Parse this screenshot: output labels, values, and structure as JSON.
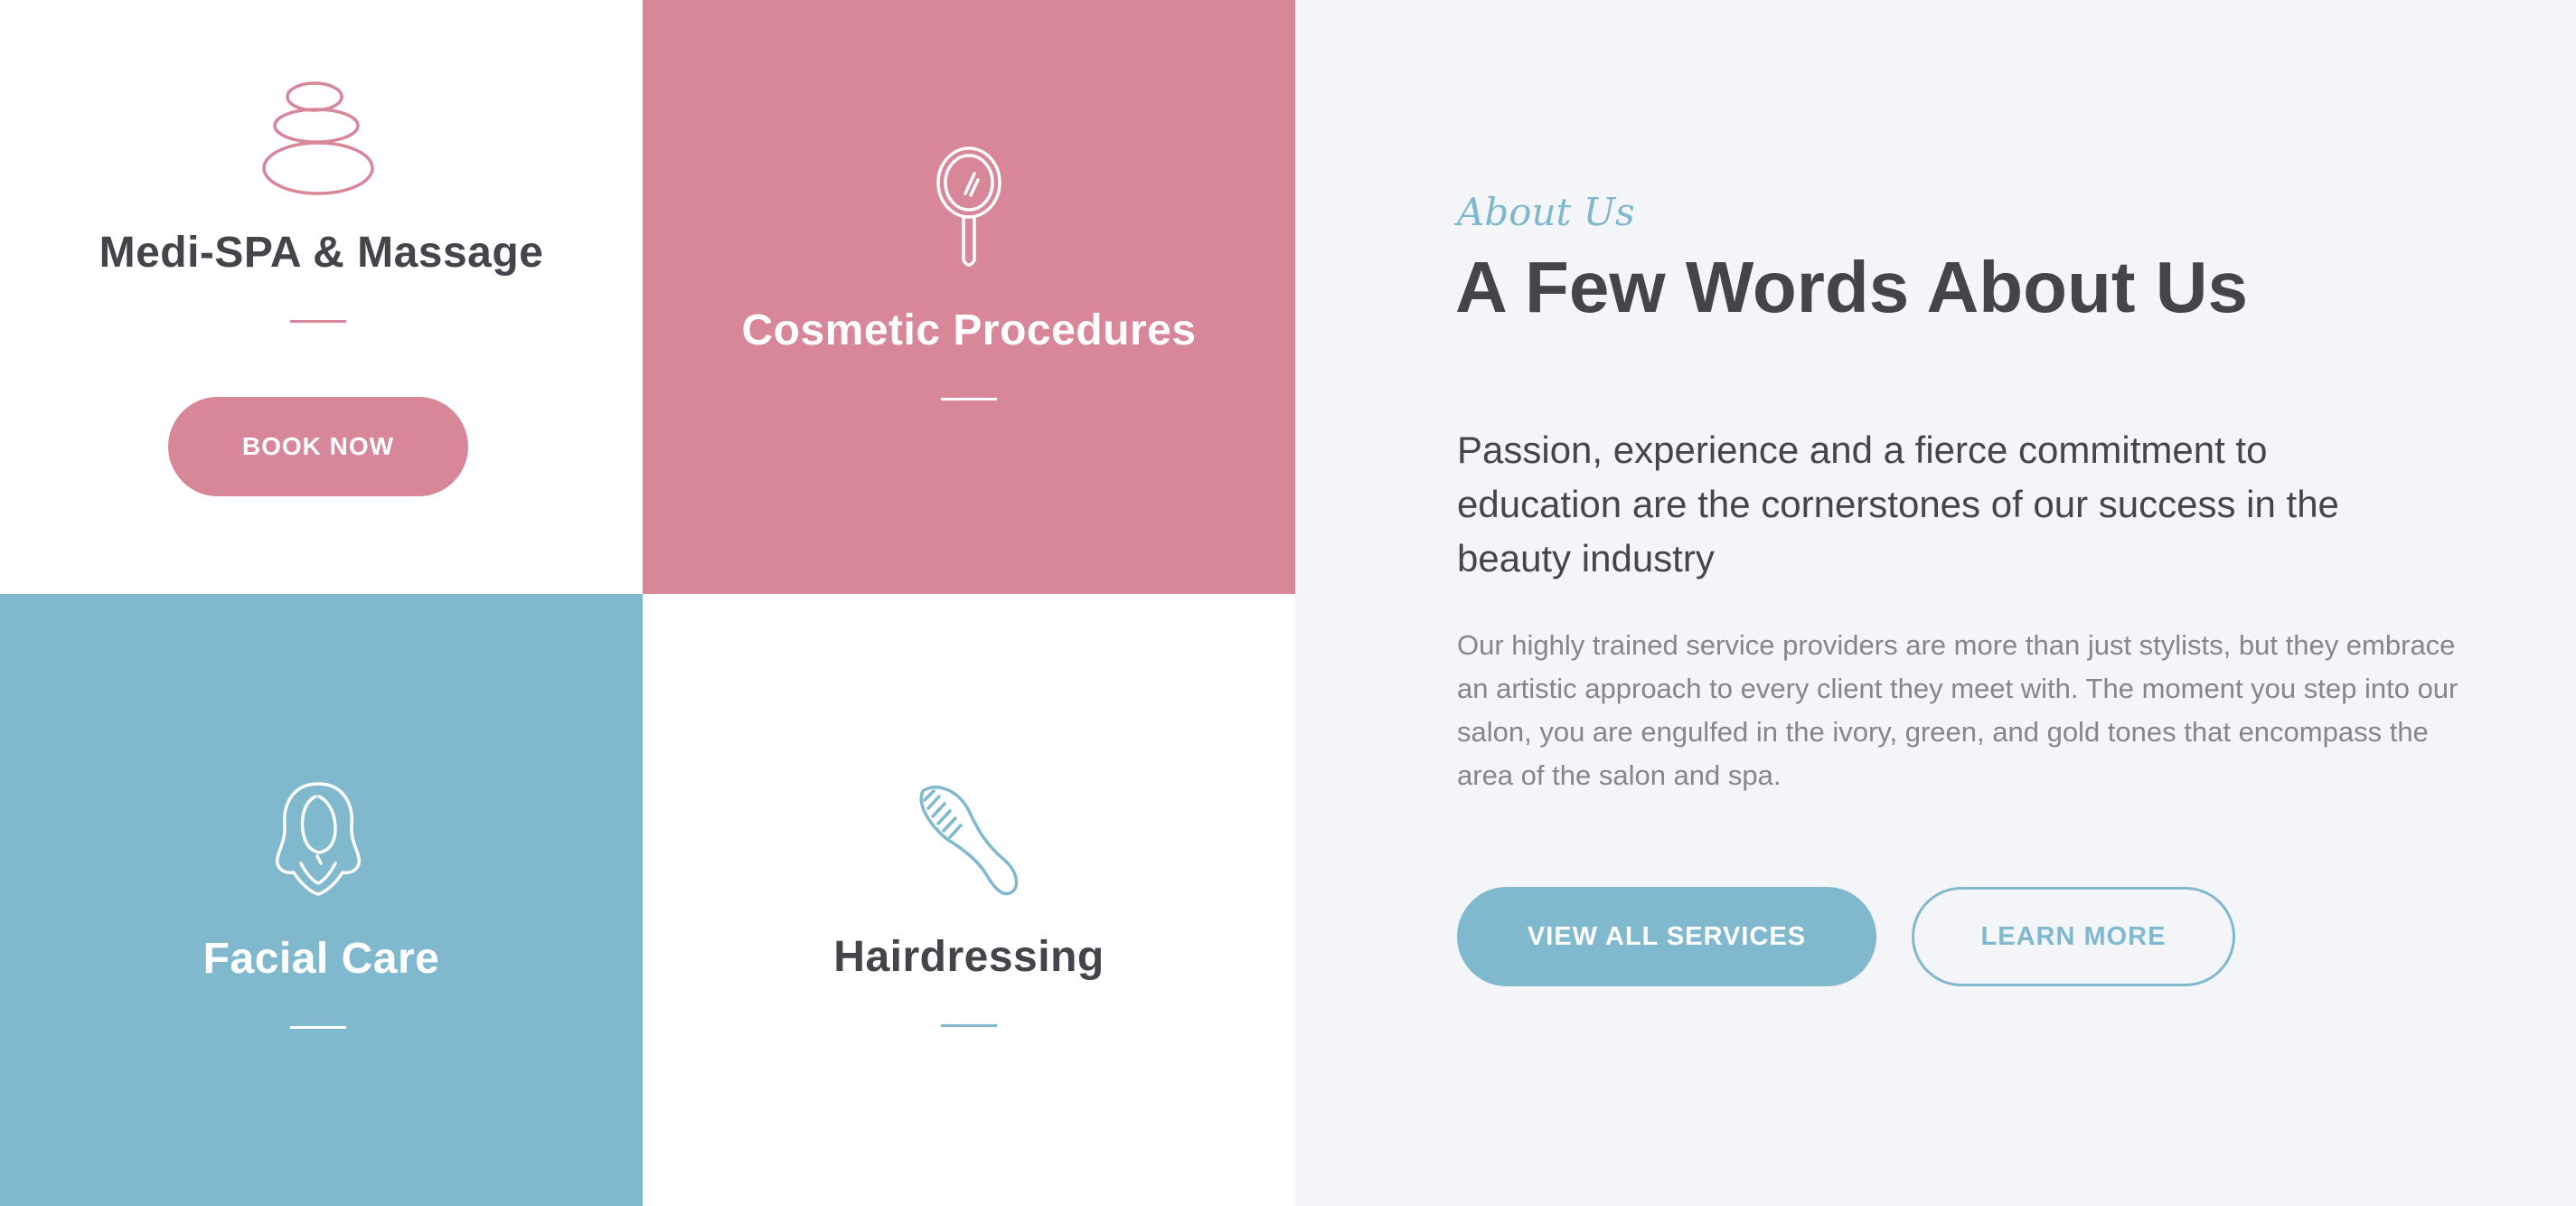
{
  "colors": {
    "pink": "#d78797",
    "blue": "#80b9cd",
    "dark_text": "#43454b",
    "muted_text": "#85868a",
    "panel_bg": "#f4f5f9",
    "white": "#ffffff"
  },
  "services": [
    {
      "title": "Medi-SPA & Massage",
      "icon": "spa-stones-icon",
      "button_label": "BOOK NOW"
    },
    {
      "title": "Cosmetic Procedures",
      "icon": "hand-mirror-icon"
    },
    {
      "title": "Facial Care",
      "icon": "woman-face-icon"
    },
    {
      "title": "Hairdressing",
      "icon": "comb-icon"
    }
  ],
  "about": {
    "eyebrow": "About Us",
    "heading": "A Few Words About Us",
    "lead": "Passion, experience and a fierce commitment to education are the cornerstones of our success in the beauty industry",
    "body": "Our highly trained service providers are more than just stylists, but they embrace an artistic approach to every client they meet with. The moment you step into our salon, you are engulfed in the ivory, green, and gold tones that encompass the area of the salon and spa.",
    "primary_button": "VIEW ALL SERVICES",
    "secondary_button": "LEARN MORE"
  }
}
